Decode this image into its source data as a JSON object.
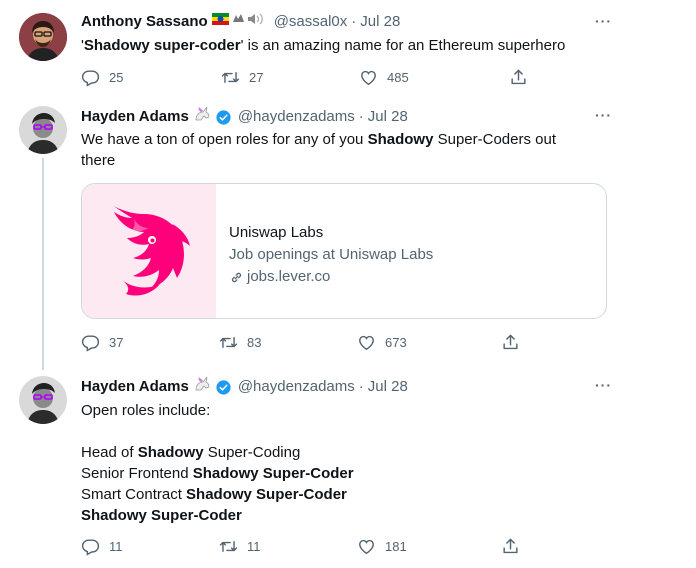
{
  "tweets": [
    {
      "name": "Anthony Sassano",
      "handle": "@sassal0x",
      "date": "Jul 28",
      "text_parts": [
        {
          "t": "'",
          "bold": false
        },
        {
          "t": "Shadowy super-coder",
          "bold": true
        },
        {
          "t": "' is an amazing name for an Ethereum superhero",
          "bold": false
        }
      ],
      "replies": "25",
      "retweets": "27",
      "likes": "485"
    },
    {
      "name": "Hayden Adams",
      "handle": "@haydenzadams",
      "date": "Jul 28",
      "line1_a": "We have a ton of open roles for any of you ",
      "line1_b": "Shadowy",
      "line1_c": " Super-Coders out",
      "line2": "there",
      "card": {
        "title": "Uniswap Labs",
        "description": "Job openings at Uniswap Labs",
        "domain": "jobs.lever.co",
        "brand_color": "#ff007a"
      },
      "replies": "37",
      "retweets": "83",
      "likes": "673"
    },
    {
      "name": "Hayden Adams",
      "handle": "@haydenzadams",
      "date": "Jul 28",
      "intro": "Open roles include:",
      "roles": [
        {
          "a": "Head of ",
          "b": "Shadowy",
          "c": " Super-Coding"
        },
        {
          "a": "Senior Frontend ",
          "b": "Shadowy Super-Coder",
          "c": ""
        },
        {
          "a": "Smart Contract ",
          "b": "Shadowy Super-Coder",
          "c": ""
        },
        {
          "a": "",
          "b": "Shadowy Super-Coder",
          "c": ""
        }
      ],
      "replies": "11",
      "retweets": "11",
      "likes": "181"
    }
  ],
  "more_label": "···",
  "colors": {
    "text": "#0f1419",
    "muted": "#536471",
    "verified": "#1d9bf0",
    "border": "#cfd9de"
  }
}
